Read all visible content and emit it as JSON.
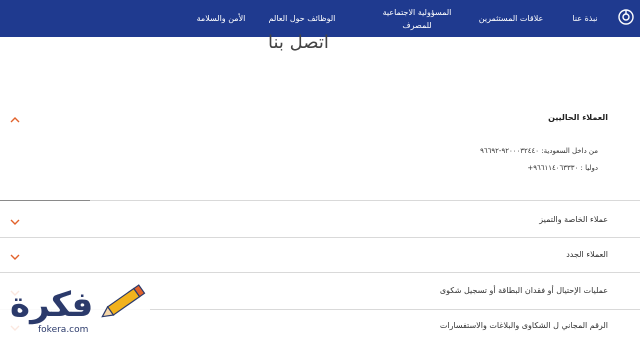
{
  "nav": {
    "items": [
      {
        "label": "نبذة عنا"
      },
      {
        "label": "علاقات المستثمرين"
      },
      {
        "label": "المسؤولية الاجتماعية للمصرف"
      },
      {
        "label": "الوظائف حول العالم"
      },
      {
        "label": "الأمن والسلامة"
      }
    ],
    "bar_color": "#1f3a8f"
  },
  "page": {
    "title": "اتصل بنا"
  },
  "accordion": {
    "accent_color": "#e2622b",
    "sections": [
      {
        "title": "العملاء الحاليين",
        "expanded": true,
        "details": [
          "من داخل السعودية: ٩٢٠٠٠٣٢٤٤٠-٩٦٦٩٢",
          "دوليا : ٩٦٦١١٤٠٦٣٣٣٠+"
        ]
      },
      {
        "title": "عملاء الخاصة والتميز",
        "expanded": false
      },
      {
        "title": "العملاء الجدد",
        "expanded": false
      },
      {
        "title": "عمليات الإحتيال أو فقدان البطاقة أو تسجيل شكوى",
        "expanded": false
      },
      {
        "title": "الرقم المجاني ل الشكاوى والبلاغات والاستفسارات",
        "expanded": false
      }
    ]
  },
  "watermark": {
    "name": "فكرة",
    "url": "fokera.com"
  }
}
